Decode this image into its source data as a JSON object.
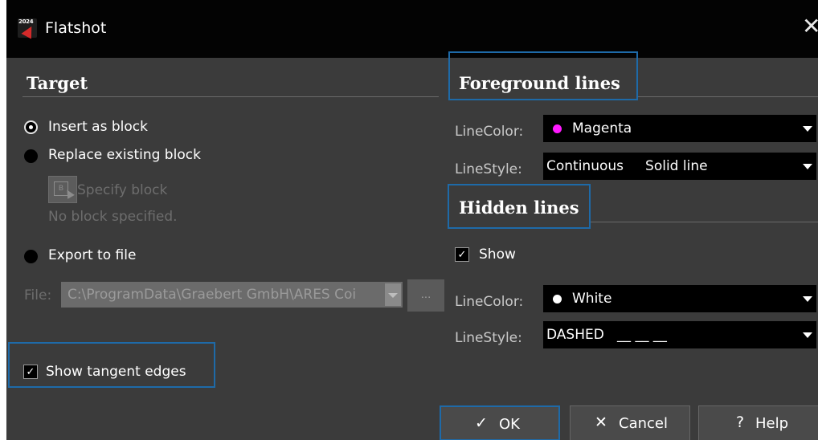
{
  "window": {
    "title": "Flatshot",
    "app_icon_text": "2024"
  },
  "icons": {
    "close": "✕",
    "ok": "✓",
    "cancel": "✕",
    "help": "?"
  },
  "target": {
    "heading": "Target",
    "insert_as_block": "Insert as block",
    "replace_existing_block": "Replace existing block",
    "specify_block": "Specify block",
    "no_block": "No block specified.",
    "export_to_file": "Export to file",
    "file_label": "File:",
    "file_value": "C:\\ProgramData\\Graebert GmbH\\ARES Coi",
    "browse_label": "...",
    "show_tangent_edges": "Show tangent edges"
  },
  "foreground": {
    "heading": "Foreground lines",
    "linecolor_label": "LineColor:",
    "linecolor_value": "Magenta",
    "linecolor_swatch": "#ff1aff",
    "linestyle_label": "LineStyle:",
    "linestyle_value": "Continuous     Solid line"
  },
  "hidden": {
    "heading": "Hidden lines",
    "show_label": "Show",
    "linecolor_label": "LineColor:",
    "linecolor_value": "White",
    "linecolor_swatch": "#ffffff",
    "linestyle_label": "LineStyle:",
    "linestyle_value": "DASHED   __ __ __"
  },
  "footer": {
    "ok_label": "OK",
    "cancel_label": "Cancel",
    "help_label": "Help"
  },
  "colors": {
    "accent": "#1e6aa8",
    "background": "#3b3b3b",
    "titlebar": "#030303"
  }
}
